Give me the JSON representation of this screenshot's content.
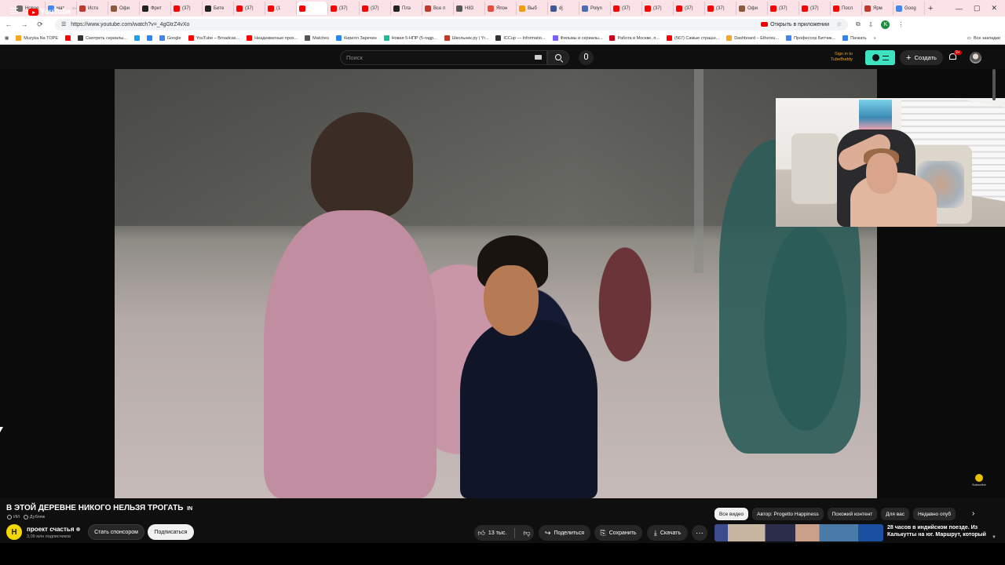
{
  "browser": {
    "tabs": [
      {
        "label": "Новое",
        "color": "#6b6b6b"
      },
      {
        "label": "мат",
        "color": "#4285f4"
      },
      {
        "label": "Исто",
        "color": "#c0392b"
      },
      {
        "label": "Офи",
        "color": "#8e5a3c"
      },
      {
        "label": "Фрит",
        "color": "#222222"
      },
      {
        "label": "(37)",
        "color": "#ff0000"
      },
      {
        "label": "Бите",
        "color": "#222222"
      },
      {
        "label": "(37)",
        "color": "#ff0000"
      },
      {
        "label": "(1",
        "color": "#ff0000"
      },
      {
        "label": "",
        "color": "#ff0000",
        "active": true
      },
      {
        "label": "(37)",
        "color": "#ff0000"
      },
      {
        "label": "(37)",
        "color": "#ff0000"
      },
      {
        "label": "Плэ",
        "color": "#222222"
      },
      {
        "label": "Все п",
        "color": "#c0392b"
      },
      {
        "label": "Н83",
        "color": "#555555"
      },
      {
        "label": "Япон",
        "color": "#e74c3c"
      },
      {
        "label": "Выб",
        "color": "#f39c12"
      },
      {
        "label": "dj",
        "color": "#3b5998"
      },
      {
        "label": "Polyn",
        "color": "#4b6cb7"
      },
      {
        "label": "(37)",
        "color": "#ff0000"
      },
      {
        "label": "(37)",
        "color": "#ff0000"
      },
      {
        "label": "(37)",
        "color": "#ff0000"
      },
      {
        "label": "(37)",
        "color": "#ff0000"
      },
      {
        "label": "Офи",
        "color": "#8e5a3c"
      },
      {
        "label": "(37)",
        "color": "#ff0000"
      },
      {
        "label": "(37)",
        "color": "#ff0000"
      },
      {
        "label": "Посл",
        "color": "#ff0000"
      },
      {
        "label": "Ярм",
        "color": "#c0392b"
      },
      {
        "label": "Goog",
        "color": "#4285f4"
      }
    ],
    "new_tab": "+",
    "window_controls": {
      "minimize": "—",
      "maximize": "▢",
      "close": "✕"
    },
    "nav": {
      "back": "←",
      "forward": "→",
      "reload": "⟳",
      "site_info": "☰"
    },
    "url": "https://www.youtube.com/watch?v=_4gGtrZ4vXo",
    "open_in_app": "Открыть в приложении",
    "star": "☆",
    "profile_initial": "K",
    "bookmarks": [
      {
        "label": "Muzyka Na TOPE",
        "color": "#f5a623"
      },
      {
        "label": "",
        "color": "#ff0000"
      },
      {
        "label": "Смотреть сериалы...",
        "color": "#333333"
      },
      {
        "label": "",
        "color": "#1da1f2"
      },
      {
        "label": "",
        "color": "#2787f5"
      },
      {
        "label": "Google",
        "color": "#4285f4"
      },
      {
        "label": "YouTube – Broadcas...",
        "color": "#ff0000"
      },
      {
        "label": "Неадекватные прох...",
        "color": "#ff0000"
      },
      {
        "label": "Matches",
        "color": "#555555"
      },
      {
        "label": "Кирилл Заречин",
        "color": "#2787f5"
      },
      {
        "label": "Новая 5-НПР (5-гидр...",
        "color": "#1abc9c"
      },
      {
        "label": "Школьник.ру | Yr...",
        "color": "#c0392b"
      },
      {
        "label": "ICCup — Informatio...",
        "color": "#333333"
      },
      {
        "label": "Фильмы и сериалы...",
        "color": "#7b61ff"
      },
      {
        "label": "Работа в Москве, п...",
        "color": "#d0021b"
      },
      {
        "label": "(567) Самые страшн...",
        "color": "#ff0000"
      },
      {
        "label": "Dashboard – Ethereu...",
        "color": "#f5a623"
      },
      {
        "label": "Профессор Битчик...",
        "color": "#4285f4"
      },
      {
        "label": "Пачкать",
        "color": "#2787f5"
      }
    ],
    "bookmarks_more": "»",
    "all_bookmarks": "Все закладки"
  },
  "youtube": {
    "logo_text": "YouTube",
    "region": "BY",
    "search_placeholder": "Поиск",
    "signin_line1": "Sign in to",
    "signin_line2": "TubeBuddy",
    "create_label": "Создать",
    "notification_badge": "9+"
  },
  "video": {
    "title": "В ЭТОЙ ДЕРЕВНЕ НИКОГО НЕЛЬЗЯ ТРОГАТЬ",
    "title_flag": "IN",
    "tag_ai": "ИИ",
    "tag_dub": "Дубляж",
    "watermark": "Subscribe"
  },
  "channel": {
    "avatar_letter": "H",
    "name": "проект счастья",
    "subscribers": "3,09 млн подписчиков",
    "sponsor_label": "Стать спонсором",
    "subscribe_label": "Подписаться"
  },
  "actions": {
    "likes": "13 тыс.",
    "share": "Поделиться",
    "save": "Сохранить",
    "download": "Скачать",
    "more": "···"
  },
  "chips": [
    {
      "label": "Все видео",
      "active": true
    },
    {
      "label": "Автор: Progetto Happiness",
      "active": false
    },
    {
      "label": "Похожий контент",
      "active": false
    },
    {
      "label": "Для вас",
      "active": false
    },
    {
      "label": "Недавно опуб",
      "active": false
    }
  ],
  "chips_next": "›",
  "recommendation": {
    "title": "28 часов в индийском поезде. Из Калькутты на юг. Маршрут, который"
  }
}
